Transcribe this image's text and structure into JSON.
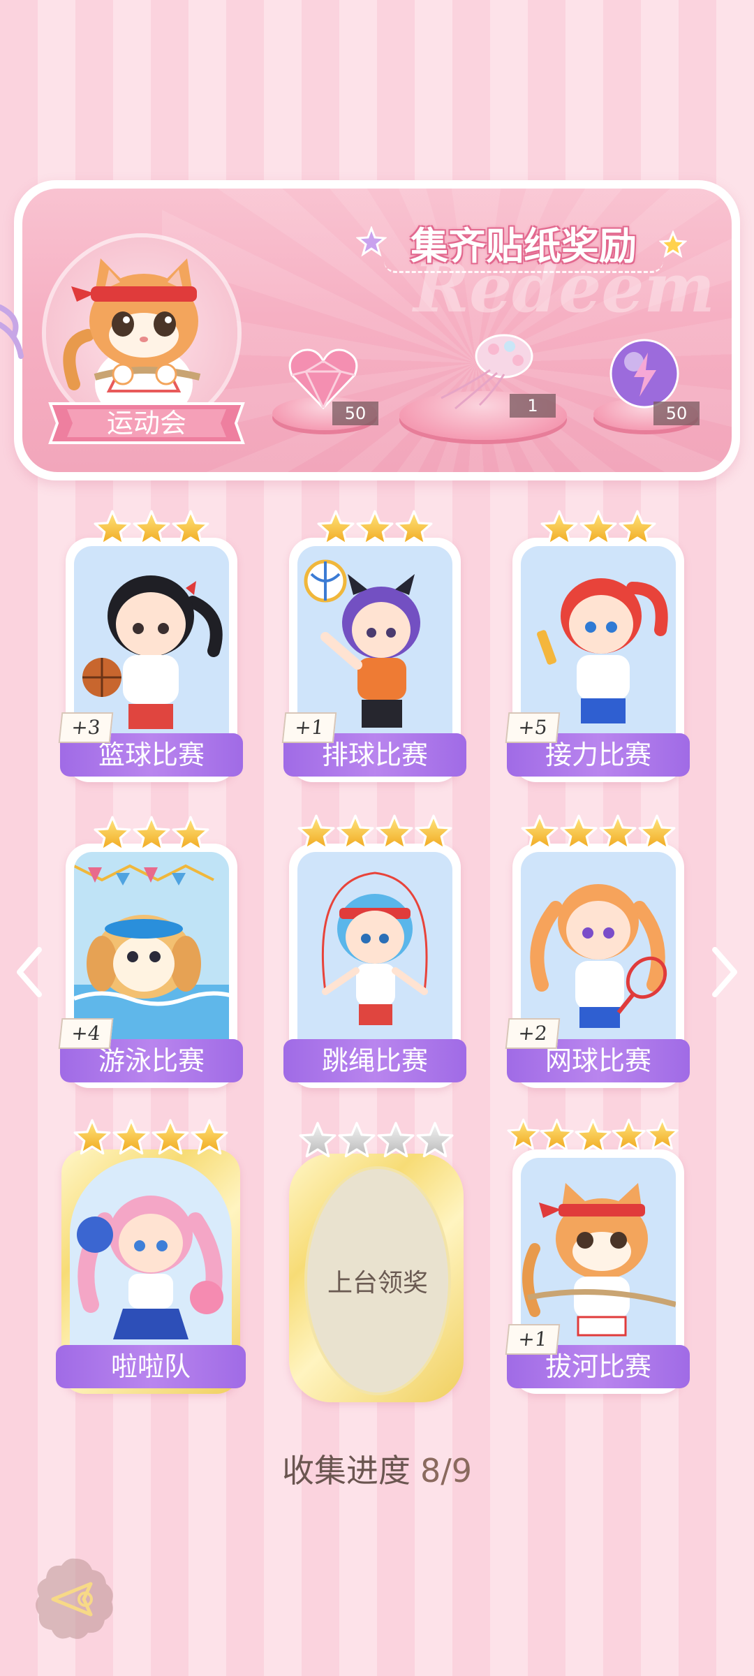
{
  "banner": {
    "title": "集齐贴纸奖励",
    "watermark": "Redeem",
    "event_label": "运动会",
    "rewards": [
      {
        "icon": "heart-gem-icon",
        "count": "50"
      },
      {
        "icon": "jellyfish-decoration-icon",
        "count": "1"
      },
      {
        "icon": "purple-lightning-orb-icon",
        "count": "50"
      }
    ]
  },
  "stickers": [
    {
      "label": "篮球比赛",
      "stars": 3,
      "bonus": "+3"
    },
    {
      "label": "排球比赛",
      "stars": 3,
      "bonus": "+1"
    },
    {
      "label": "接力比赛",
      "stars": 3,
      "bonus": "+5"
    },
    {
      "label": "游泳比赛",
      "stars": 3,
      "bonus": "+4"
    },
    {
      "label": "跳绳比赛",
      "stars": 4,
      "bonus": ""
    },
    {
      "label": "网球比赛",
      "stars": 4,
      "bonus": "+2"
    },
    {
      "label": "啦啦队",
      "stars": 4,
      "bonus": ""
    },
    {
      "label": "上台领奖",
      "stars": 4,
      "bonus": "",
      "locked": true
    },
    {
      "label": "拔河比赛",
      "stars": 5,
      "bonus": "+1"
    }
  ],
  "progress": {
    "label": "收集进度",
    "value": "8/9"
  },
  "colors": {
    "label_purple": "#a06be6",
    "star_gold": "#f5c33b",
    "pink_bg": "#fbd3de"
  }
}
